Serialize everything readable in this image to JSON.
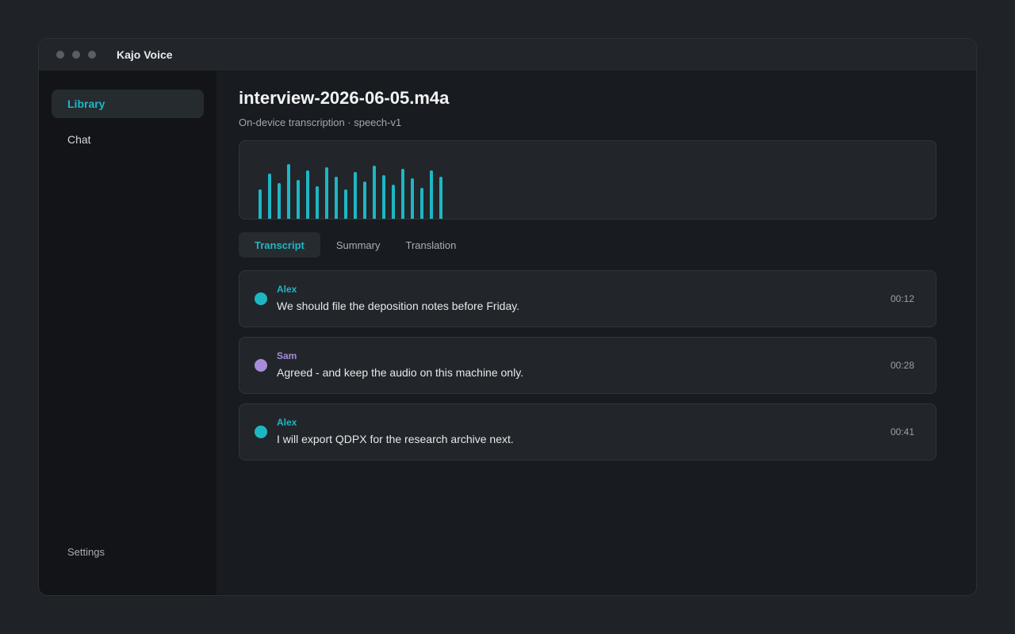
{
  "window": {
    "title": "Kajo Voice",
    "traffic_lights": [
      "close",
      "minimize",
      "zoom"
    ]
  },
  "sidebar": {
    "items": [
      {
        "label": "Library",
        "active": true
      },
      {
        "label": "Chat",
        "active": false
      }
    ],
    "settings_label": "Settings"
  },
  "file": {
    "name": "interview-2026-06-05.m4a",
    "subtitle": "On-device transcription · speech-v1"
  },
  "waveform": {
    "color": "#1fb6c4",
    "levels": [
      0.39,
      0.59,
      0.47,
      0.71,
      0.51,
      0.63,
      0.43,
      0.67,
      0.55,
      0.39,
      0.61,
      0.49,
      0.69,
      0.57,
      0.45,
      0.65,
      0.53,
      0.41,
      0.63,
      0.55
    ]
  },
  "tabs": [
    {
      "label": "Transcript",
      "active": true
    },
    {
      "label": "Summary",
      "active": false
    },
    {
      "label": "Translation",
      "active": false
    }
  ],
  "segments": [
    {
      "speaker": "Alex",
      "color": "#1fb6c4",
      "text": "We should file the deposition notes before Friday.",
      "time": "00:12"
    },
    {
      "speaker": "Sam",
      "color": "#a78bdb",
      "text": "Agreed - and keep the audio on this machine only.",
      "time": "00:28"
    },
    {
      "speaker": "Alex",
      "color": "#1fb6c4",
      "text": "I will export QDPX for the research archive next.",
      "time": "00:41"
    }
  ]
}
